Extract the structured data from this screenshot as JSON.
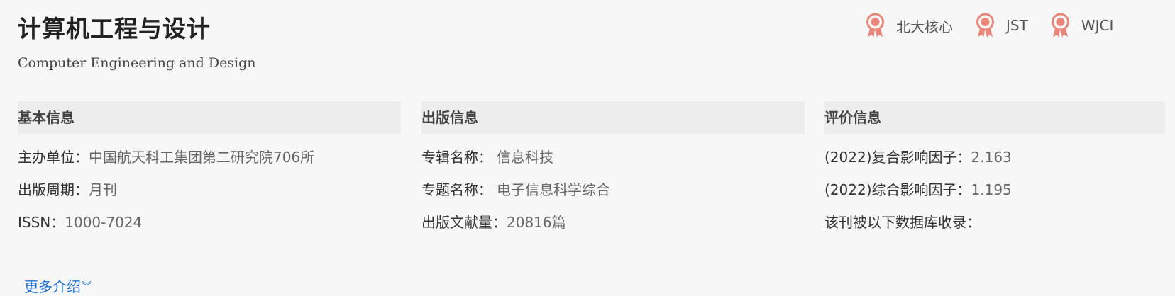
{
  "journal": {
    "title": "计算机工程与设计",
    "subtitle": "Computer Engineering and Design"
  },
  "badges": [
    {
      "icon": "award-icon",
      "label": "北大核心"
    },
    {
      "icon": "award-icon",
      "label": "JST"
    },
    {
      "icon": "award-icon",
      "label": "WJCI"
    }
  ],
  "colors": {
    "badge": "#e9877a",
    "link": "#1f6fd1"
  },
  "basic": {
    "heading": "基本信息",
    "rows": [
      {
        "key": "主办单位：",
        "value": "中国航天科工集团第二研究院706所"
      },
      {
        "key": "出版周期：",
        "value": "月刊"
      },
      {
        "key": "ISSN：",
        "value": "1000-7024"
      }
    ],
    "more_label": "更多介绍",
    "more_icon": "double-chevron-down-icon"
  },
  "publish": {
    "heading": "出版信息",
    "rows": [
      {
        "key": "专辑名称：",
        "value": "信息科技"
      },
      {
        "key": "专题名称：",
        "value": "电子信息科学综合"
      },
      {
        "key": "出版文献量：",
        "value": "20816篇"
      }
    ]
  },
  "evaluation": {
    "heading": "评价信息",
    "rows": [
      {
        "key": "(2022)复合影响因子：",
        "value": "2.163"
      },
      {
        "key": "(2022)综合影响因子：",
        "value": "1.195"
      },
      {
        "key": "该刊被以下数据库收录：",
        "value": ""
      }
    ]
  }
}
